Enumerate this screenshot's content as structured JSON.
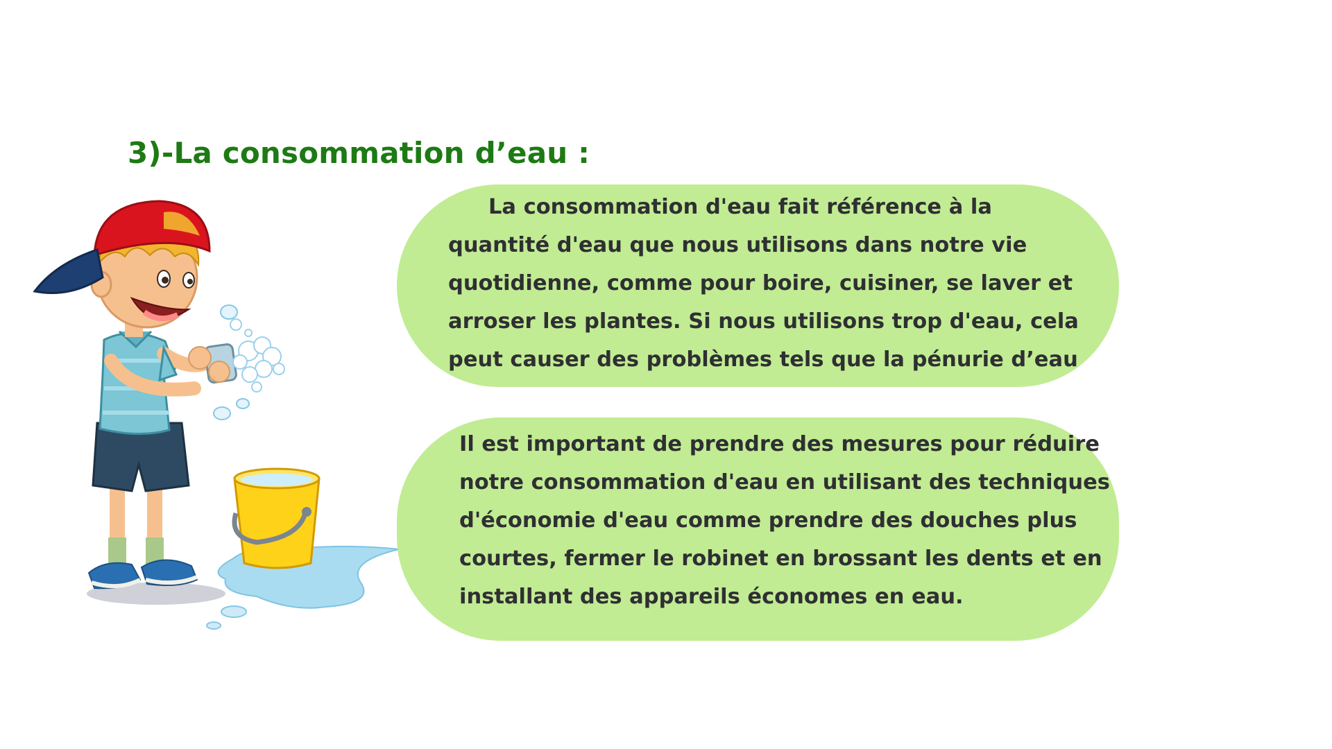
{
  "section": {
    "heading": "3)-La consommation d’eau :"
  },
  "bubbles": [
    {
      "lines": [
        "La consommation d'eau fait référence à la",
        "quantité d'eau que nous utilisons dans notre vie",
        "quotidienne, comme pour boire, cuisiner, se laver et",
        "arroser les plantes. Si nous utilisons trop d'eau, cela",
        "peut causer des problèmes tels que la pénurie d’eau"
      ]
    },
    {
      "lines": [
        "Il est important de prendre des mesures pour réduire",
        "notre consommation d'eau en utilisant des techniques",
        "d'économie d'eau comme prendre des douches plus",
        "courtes, fermer le robinet en brossant les dents et en",
        "installant des appareils économes en eau."
      ]
    }
  ],
  "illustration": {
    "subject": "boy-washing-hands-with-bucket",
    "colors": {
      "cap": "#d9141e",
      "cap_brim": "#1d3f72",
      "shirt": "#7cc6d6",
      "shorts": "#2e4a62",
      "bucket": "#ffd21a",
      "water": "#a9dcf0",
      "skin": "#f6c08e",
      "hair": "#f2b530"
    }
  },
  "colors": {
    "heading": "#1d7a14",
    "bubble_fill": "#c1ec93",
    "body_text": "#2f2f33"
  }
}
